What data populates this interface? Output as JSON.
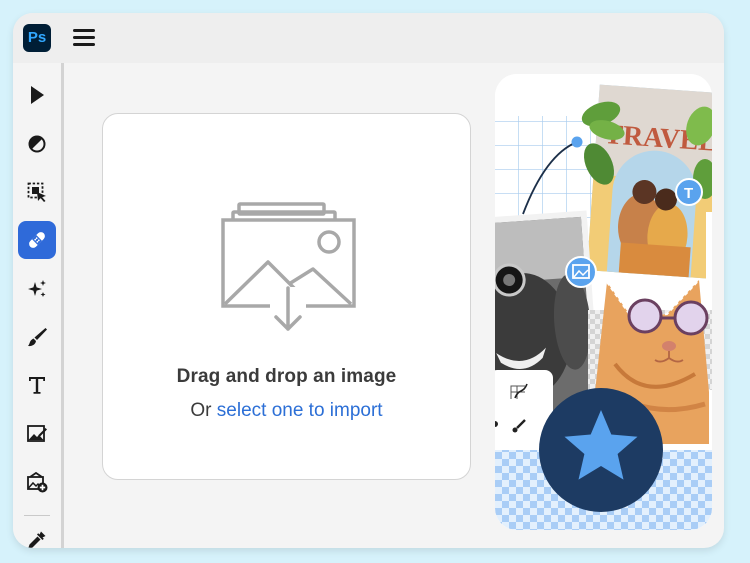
{
  "app": {
    "logo_text": "Ps",
    "menu_icon": "hamburger-menu-icon",
    "accent_color": "#2f6ad9",
    "brand_color": "#001e36"
  },
  "toolbar": {
    "tools": [
      {
        "name": "select-tool",
        "icon": "pointer-arrow-icon",
        "active": false
      },
      {
        "name": "adjust-tool",
        "icon": "adjustment-circle-icon",
        "active": false
      },
      {
        "name": "object-select-tool",
        "icon": "object-selection-icon",
        "active": false
      },
      {
        "name": "heal-tool",
        "icon": "bandage-icon",
        "active": true
      },
      {
        "name": "generative-tool",
        "icon": "sparkles-icon",
        "active": false
      },
      {
        "name": "brush-tool",
        "icon": "brush-icon",
        "active": false
      },
      {
        "name": "text-tool",
        "icon": "type-t-icon",
        "active": false
      },
      {
        "name": "image-edit-tool",
        "icon": "image-edit-icon",
        "active": false
      },
      {
        "name": "add-image-tool",
        "icon": "image-add-icon",
        "active": false
      },
      {
        "name": "eyedropper-tool",
        "icon": "eyedropper-icon",
        "active": false
      }
    ]
  },
  "drop_zone": {
    "icon": "image-stack-download-icon",
    "title": "Drag and drop an image",
    "subtitle_prefix": "Or",
    "subtitle_link": "select one to import"
  },
  "promo": {
    "banner_text": "TRAVEL",
    "badge_star_icon": "star-icon",
    "text_badge": "T",
    "image_badge_icon": "image-icon"
  }
}
